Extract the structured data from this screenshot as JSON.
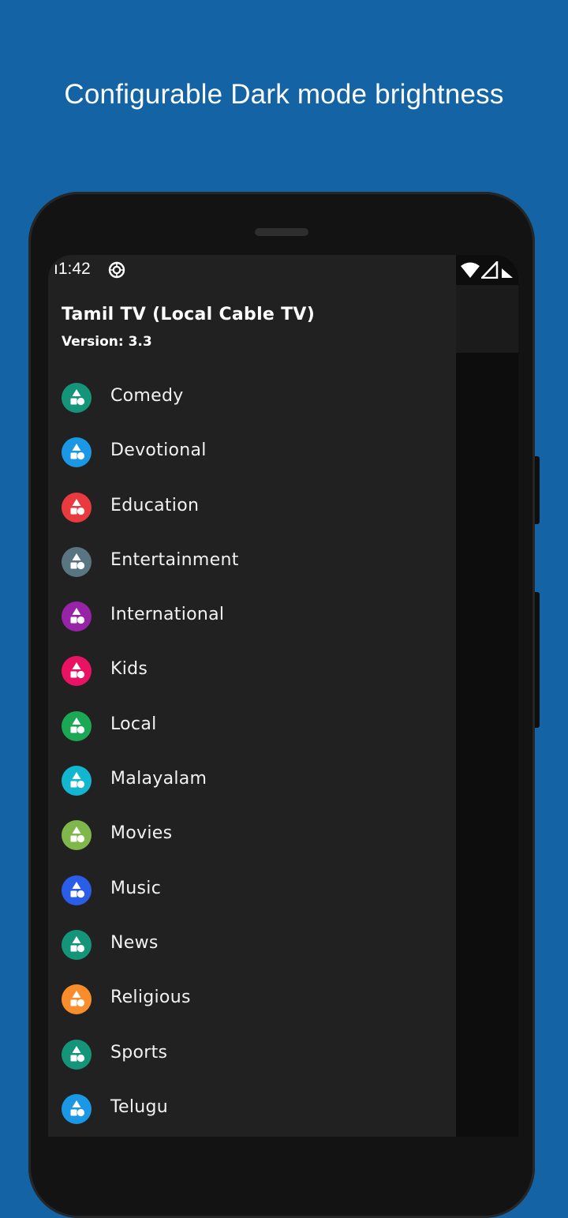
{
  "headline": "Configurable Dark mode brightness",
  "status_bar": {
    "time": "1:42",
    "display_time": "ı1:42"
  },
  "drawer": {
    "title": "Tamil TV (Local Cable TV)",
    "version": "Version: 3.3"
  },
  "categories": [
    {
      "label": "Comedy",
      "icon": "category-shapes-icon",
      "color": "#14957a"
    },
    {
      "label": "Devotional",
      "icon": "category-shapes-icon",
      "color": "#1a97e5"
    },
    {
      "label": "Education",
      "icon": "category-shapes-icon",
      "color": "#e83a3f"
    },
    {
      "label": "Entertainment",
      "icon": "category-shapes-icon",
      "color": "#5a7582"
    },
    {
      "label": "International",
      "icon": "category-shapes-icon",
      "color": "#9723a6"
    },
    {
      "label": "Kids",
      "icon": "category-shapes-icon",
      "color": "#ea1262"
    },
    {
      "label": "Local",
      "icon": "category-shapes-icon",
      "color": "#1ba854"
    },
    {
      "label": "Malayalam",
      "icon": "category-shapes-icon",
      "color": "#13b6cf"
    },
    {
      "label": "Movies",
      "icon": "category-shapes-icon",
      "color": "#7fb74a"
    },
    {
      "label": "Music",
      "icon": "category-shapes-icon",
      "color": "#2a5de8"
    },
    {
      "label": "News",
      "icon": "category-shapes-icon",
      "color": "#14957a"
    },
    {
      "label": "Religious",
      "icon": "category-shapes-icon",
      "color": "#f98d2c"
    },
    {
      "label": "Sports",
      "icon": "category-shapes-icon",
      "color": "#14957a"
    },
    {
      "label": "Telugu",
      "icon": "category-shapes-icon",
      "color": "#1a97e5"
    }
  ],
  "colors": {
    "page_background": "#1464a5",
    "drawer_background": "#212121",
    "scrim": "#0d0d0d"
  }
}
